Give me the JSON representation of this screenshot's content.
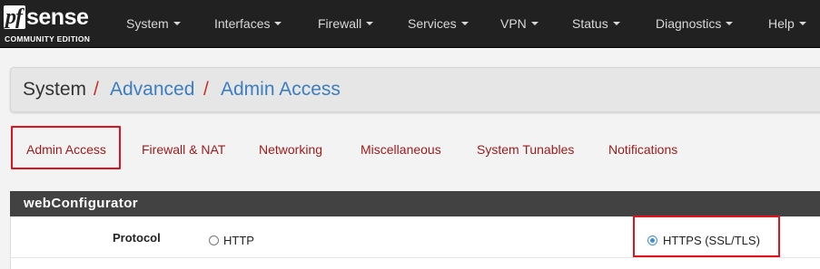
{
  "logo": {
    "pf": "pf",
    "sense": "sense",
    "edition": "COMMUNITY EDITION"
  },
  "nav": {
    "items": [
      {
        "label": "System"
      },
      {
        "label": "Interfaces"
      },
      {
        "label": "Firewall"
      },
      {
        "label": "Services"
      },
      {
        "label": "VPN"
      },
      {
        "label": "Status"
      },
      {
        "label": "Diagnostics"
      },
      {
        "label": "Help"
      }
    ]
  },
  "breadcrumb": {
    "items": [
      "System",
      "Advanced",
      "Admin Access"
    ],
    "separator": "/"
  },
  "tabs": {
    "items": [
      "Admin Access",
      "Firewall & NAT",
      "Networking",
      "Miscellaneous",
      "System Tunables",
      "Notifications"
    ],
    "active": "Admin Access"
  },
  "panel": {
    "title": "webConfigurator",
    "protocol": {
      "label": "Protocol",
      "options": [
        "HTTP",
        "HTTPS (SSL/TLS)"
      ],
      "selected": "HTTPS (SSL/TLS)"
    }
  },
  "colors": {
    "navbar": "#212121",
    "link_red": "#9e1a1a",
    "link_blue": "#3c7ebf",
    "highlight": "#e3101d",
    "radio": "#3d8fd6"
  }
}
